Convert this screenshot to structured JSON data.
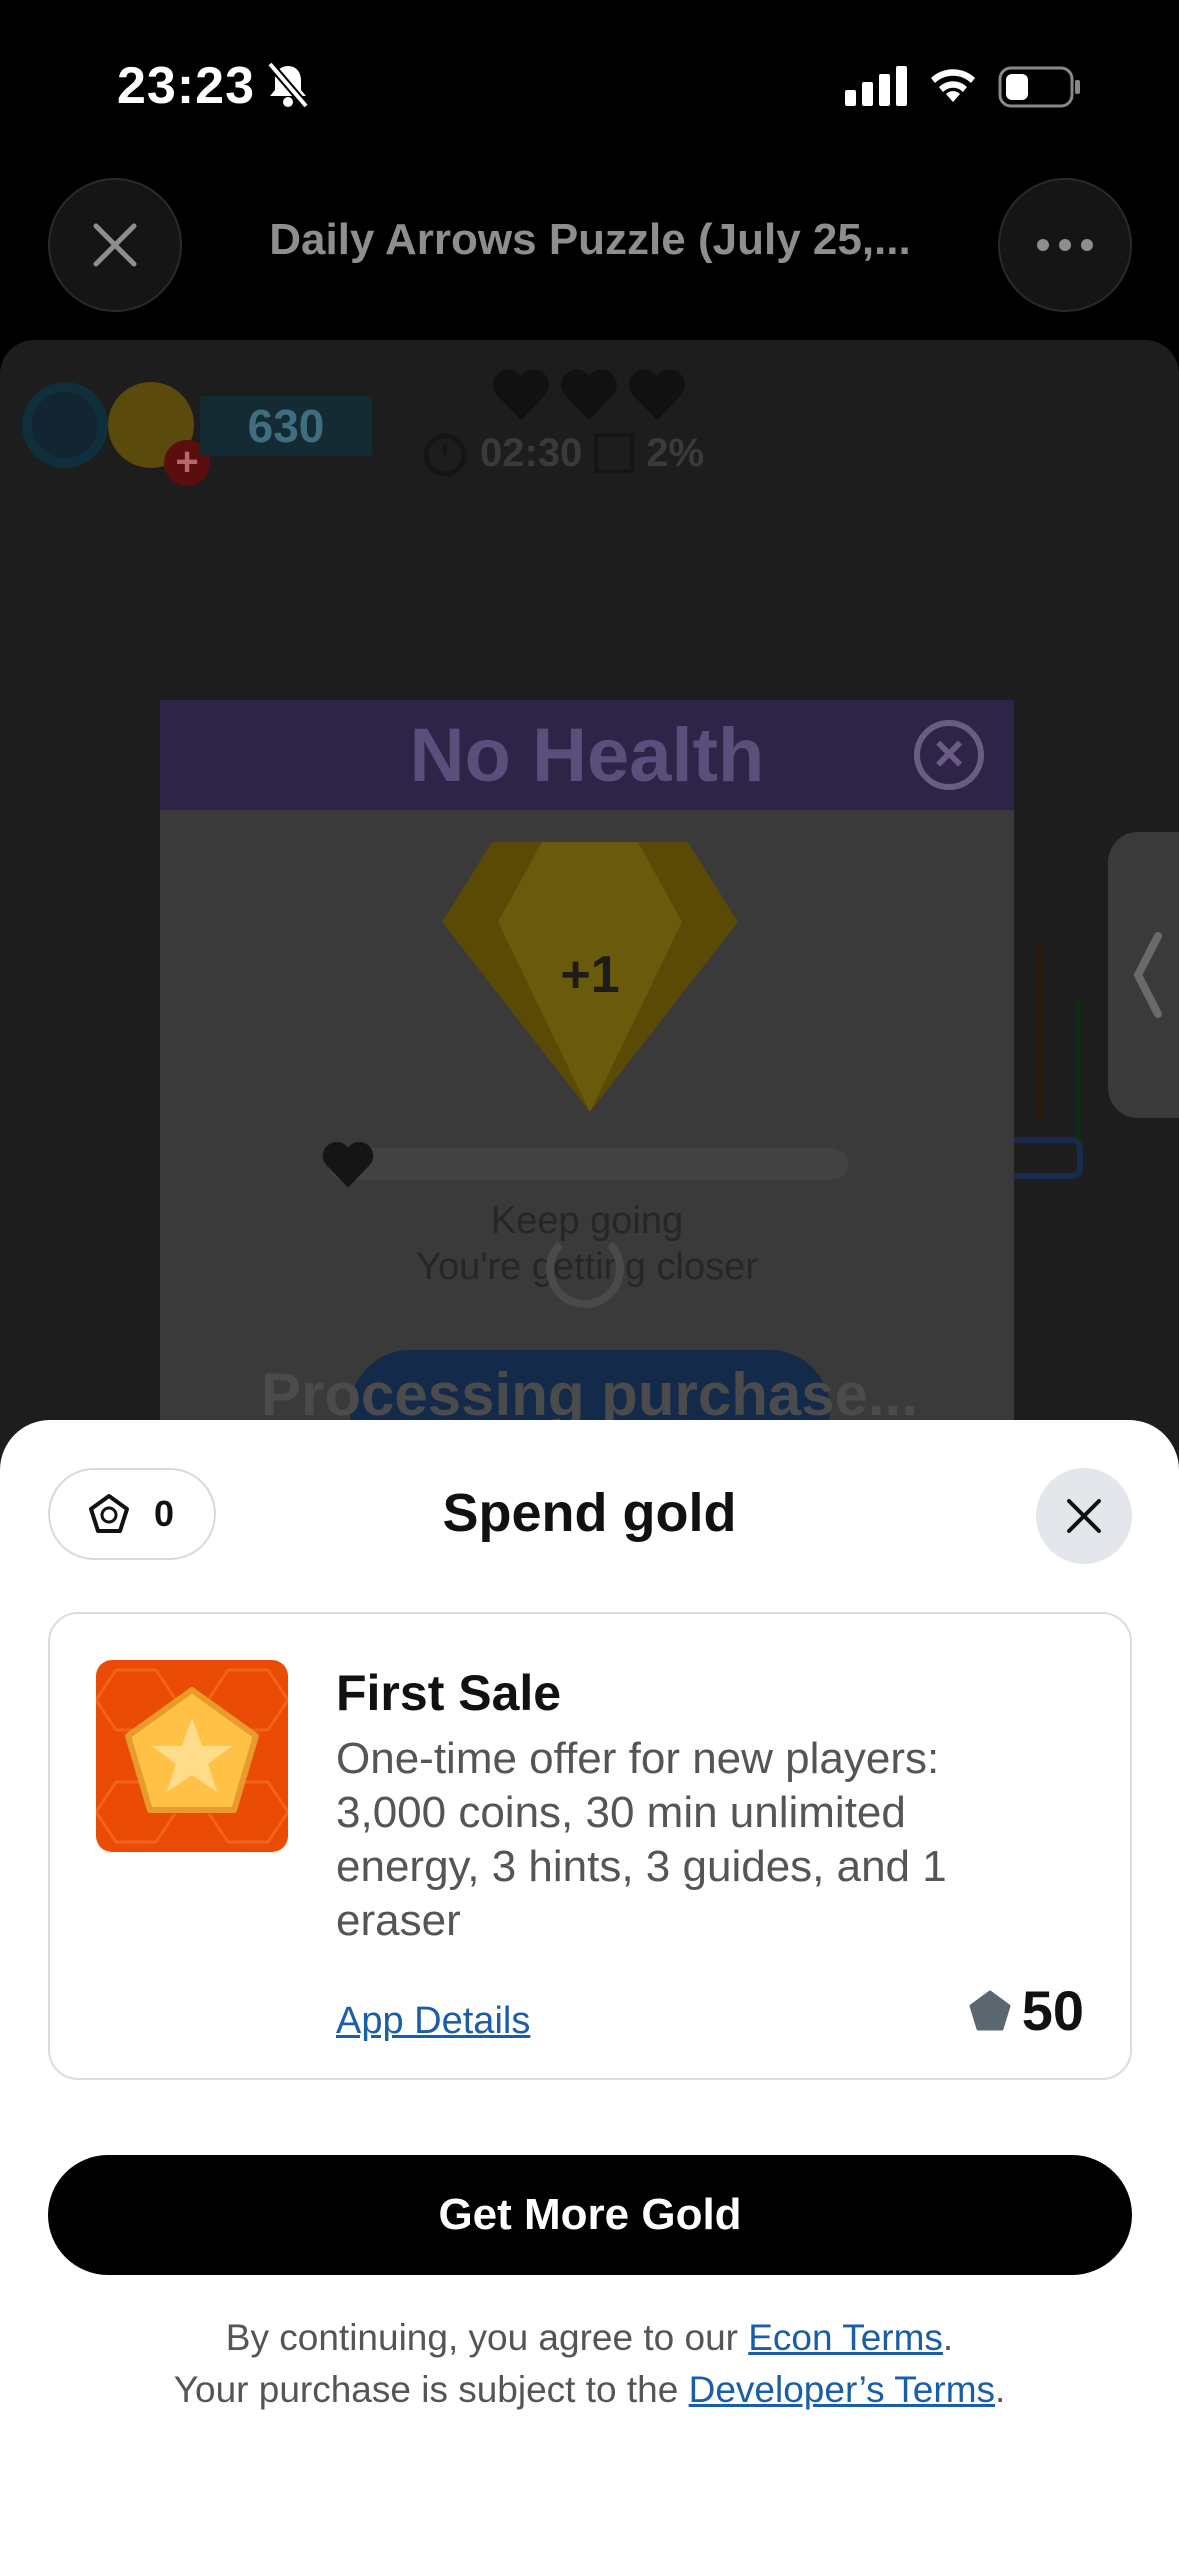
{
  "status_bar": {
    "time": "23:23"
  },
  "header": {
    "title": "Daily Arrows Puzzle (July 25,..."
  },
  "game": {
    "coins": "630",
    "timer": "02:30",
    "progress": "2%",
    "modal_title": "No Health",
    "gem_badge": "+1",
    "keep_going": "Keep going",
    "getting_closer": "You're getting closer",
    "processing": "Processing purchase..."
  },
  "sheet": {
    "gold_balance": "0",
    "title": "Spend gold",
    "product": {
      "name": "First Sale",
      "description": "One-time offer for new players: 3,000 coins, 30 min unlimited energy, 3 hints, 3 guides, and 1 eraser",
      "details_link": "App Details",
      "price": "50"
    },
    "cta": "Get More Gold",
    "legal": {
      "line1_prefix": "By continuing, you agree to our ",
      "econ_terms": "Econ Terms",
      "line1_suffix": ".",
      "line2_prefix": "Your purchase is subject to the ",
      "dev_terms": "Developer’s Terms",
      "line2_suffix": "."
    }
  },
  "colors": {
    "accent_link": "#1a5ea8",
    "thumb_orange": "#ea4b05",
    "cta_black": "#000000"
  },
  "icons": [
    "close-icon",
    "more-icon",
    "gold-icon",
    "star-badge-icon",
    "silent-bell-icon",
    "signal-icon",
    "wifi-icon",
    "battery-icon"
  ]
}
